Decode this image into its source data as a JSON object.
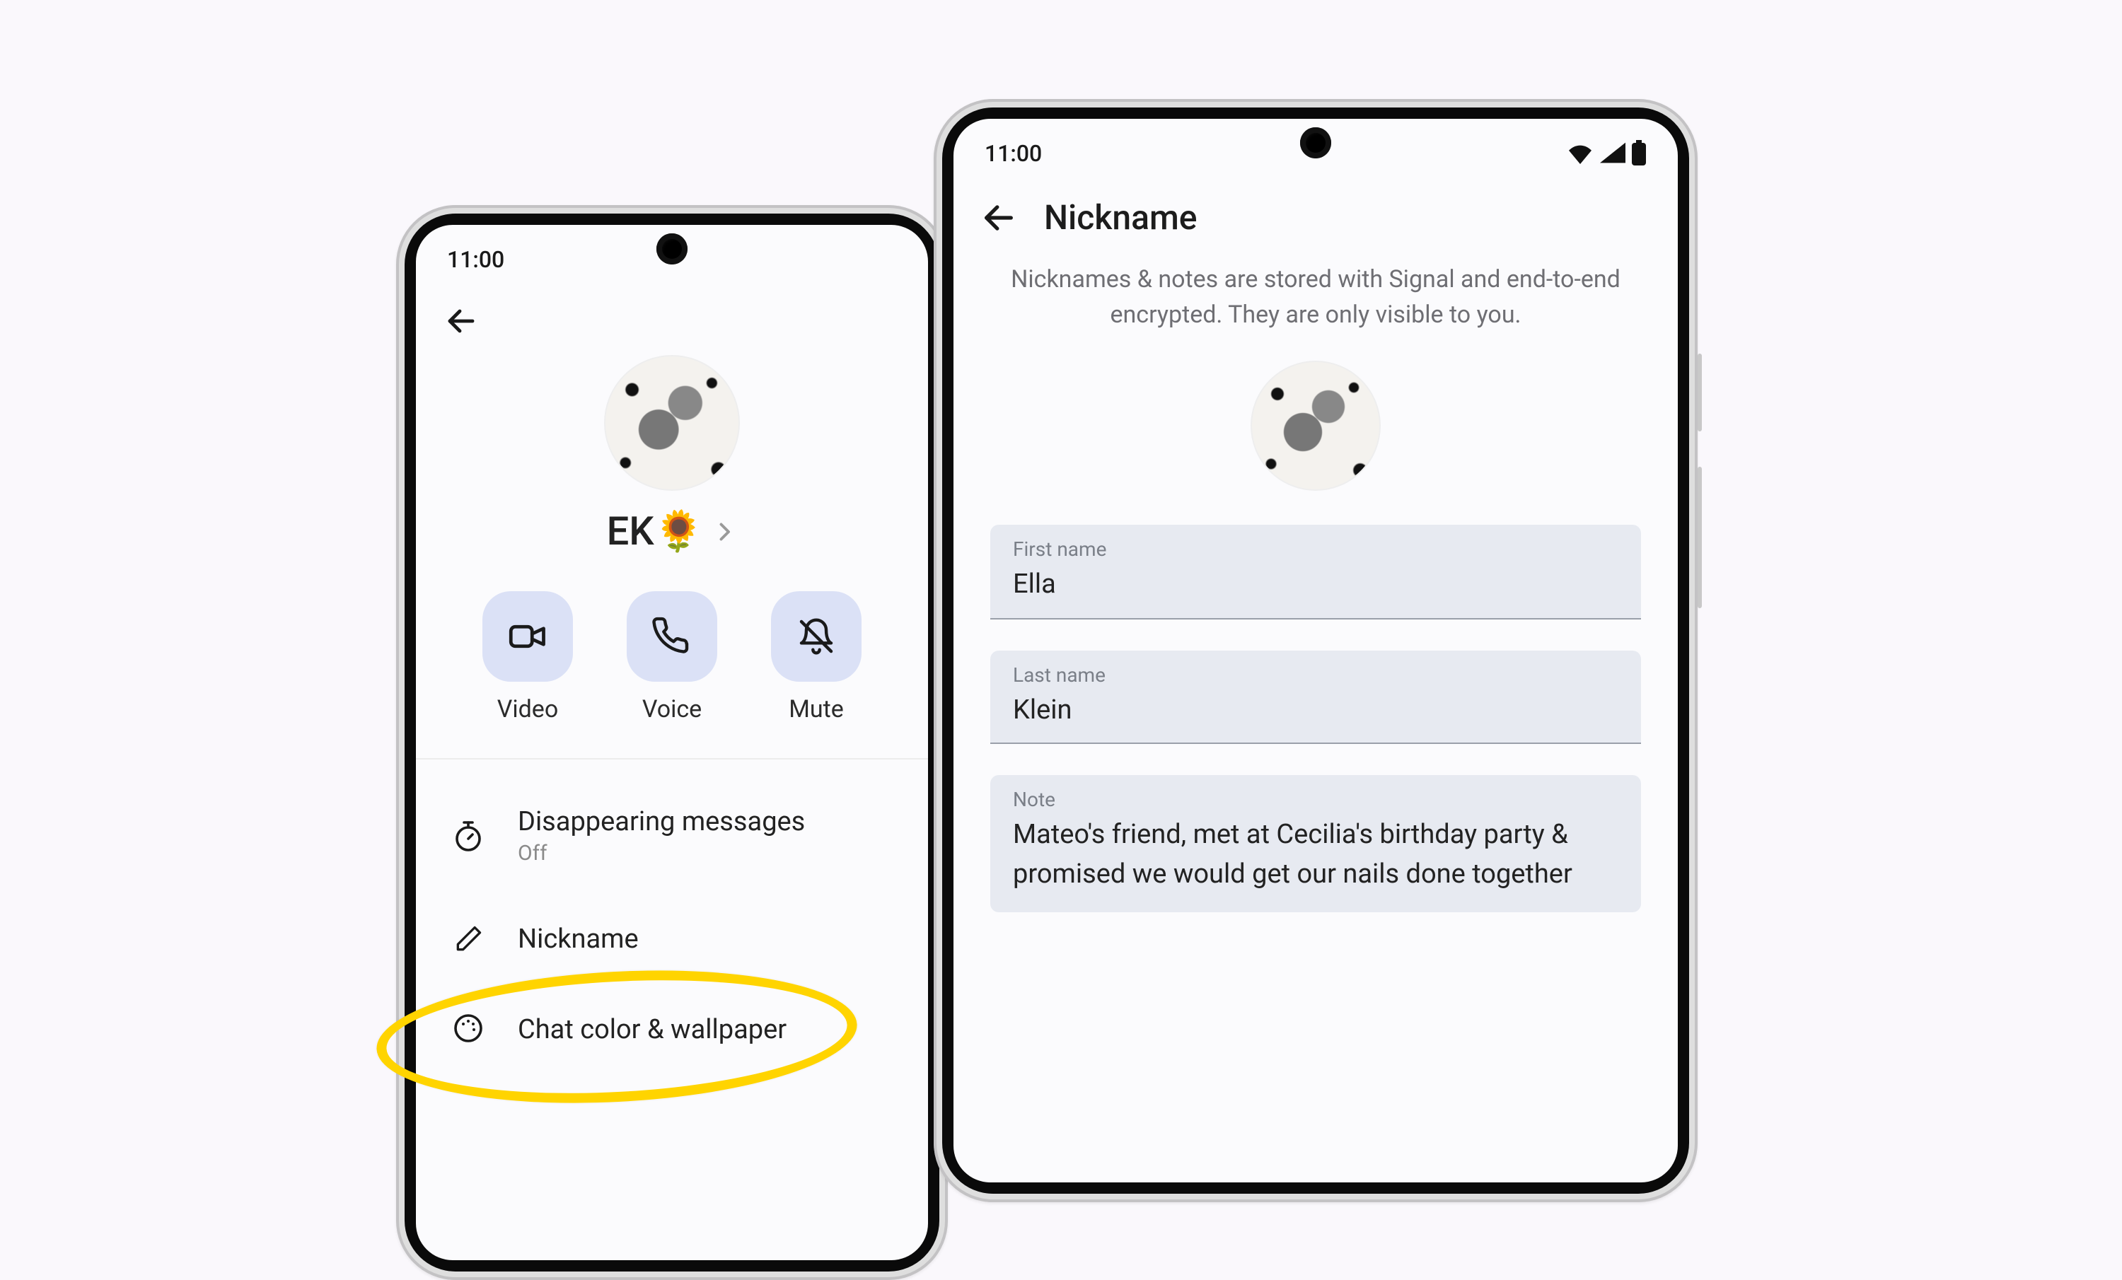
{
  "status": {
    "time": "11:00"
  },
  "left": {
    "contact_name": "EK🌻",
    "actions": {
      "video": "Video",
      "voice": "Voice",
      "mute": "Mute"
    },
    "settings": {
      "disappearing": {
        "title": "Disappearing messages",
        "sub": "Off"
      },
      "nickname": {
        "title": "Nickname"
      },
      "chatcolor": {
        "title": "Chat color & wallpaper"
      }
    }
  },
  "right": {
    "title": "Nickname",
    "info": "Nicknames & notes are stored with Signal and end-to-end encrypted. They are only visible to you.",
    "first_name": {
      "label": "First name",
      "value": "Ella"
    },
    "last_name": {
      "label": "Last name",
      "value": "Klein"
    },
    "note": {
      "label": "Note",
      "value": "Mateo's friend, met at Cecilia's birthday party & promised we would get our nails done together"
    }
  }
}
